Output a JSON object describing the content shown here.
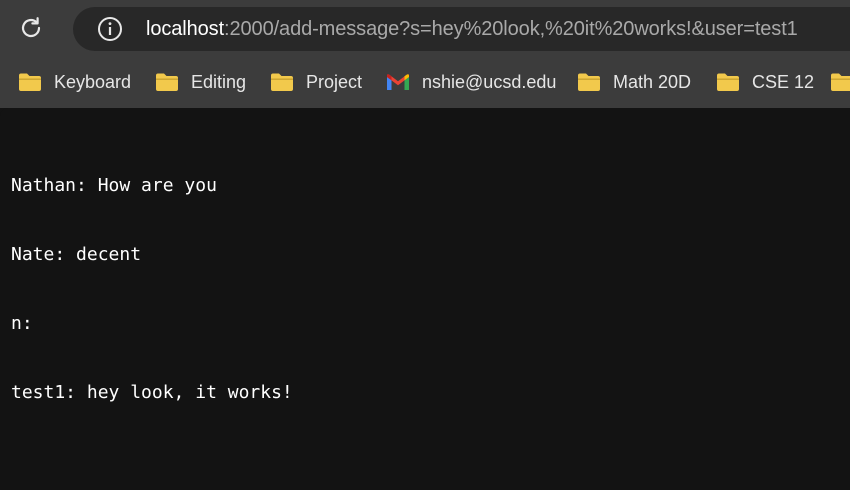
{
  "browser": {
    "url": {
      "host": "localhost",
      "rest": ":2000/add-message?s=hey%20look,%20it%20works!&user=test1"
    },
    "bookmarks": [
      {
        "label": "Keyboard",
        "icon": "folder-icon"
      },
      {
        "label": "Editing",
        "icon": "folder-icon"
      },
      {
        "label": "Project",
        "icon": "folder-icon"
      },
      {
        "label": "nshie@ucsd.edu",
        "icon": "gmail-icon"
      },
      {
        "label": "Math 20D",
        "icon": "folder-icon"
      },
      {
        "label": "CSE 12",
        "icon": "folder-icon"
      }
    ]
  },
  "page": {
    "messages": [
      "Nathan: How are you",
      "Nate: decent",
      "n:",
      "test1: hey look, it works!"
    ]
  },
  "colors": {
    "toolbar": "#3c3c3c",
    "omnibox": "#282828",
    "page_background": "#131313",
    "folder": "#f2c94c"
  }
}
